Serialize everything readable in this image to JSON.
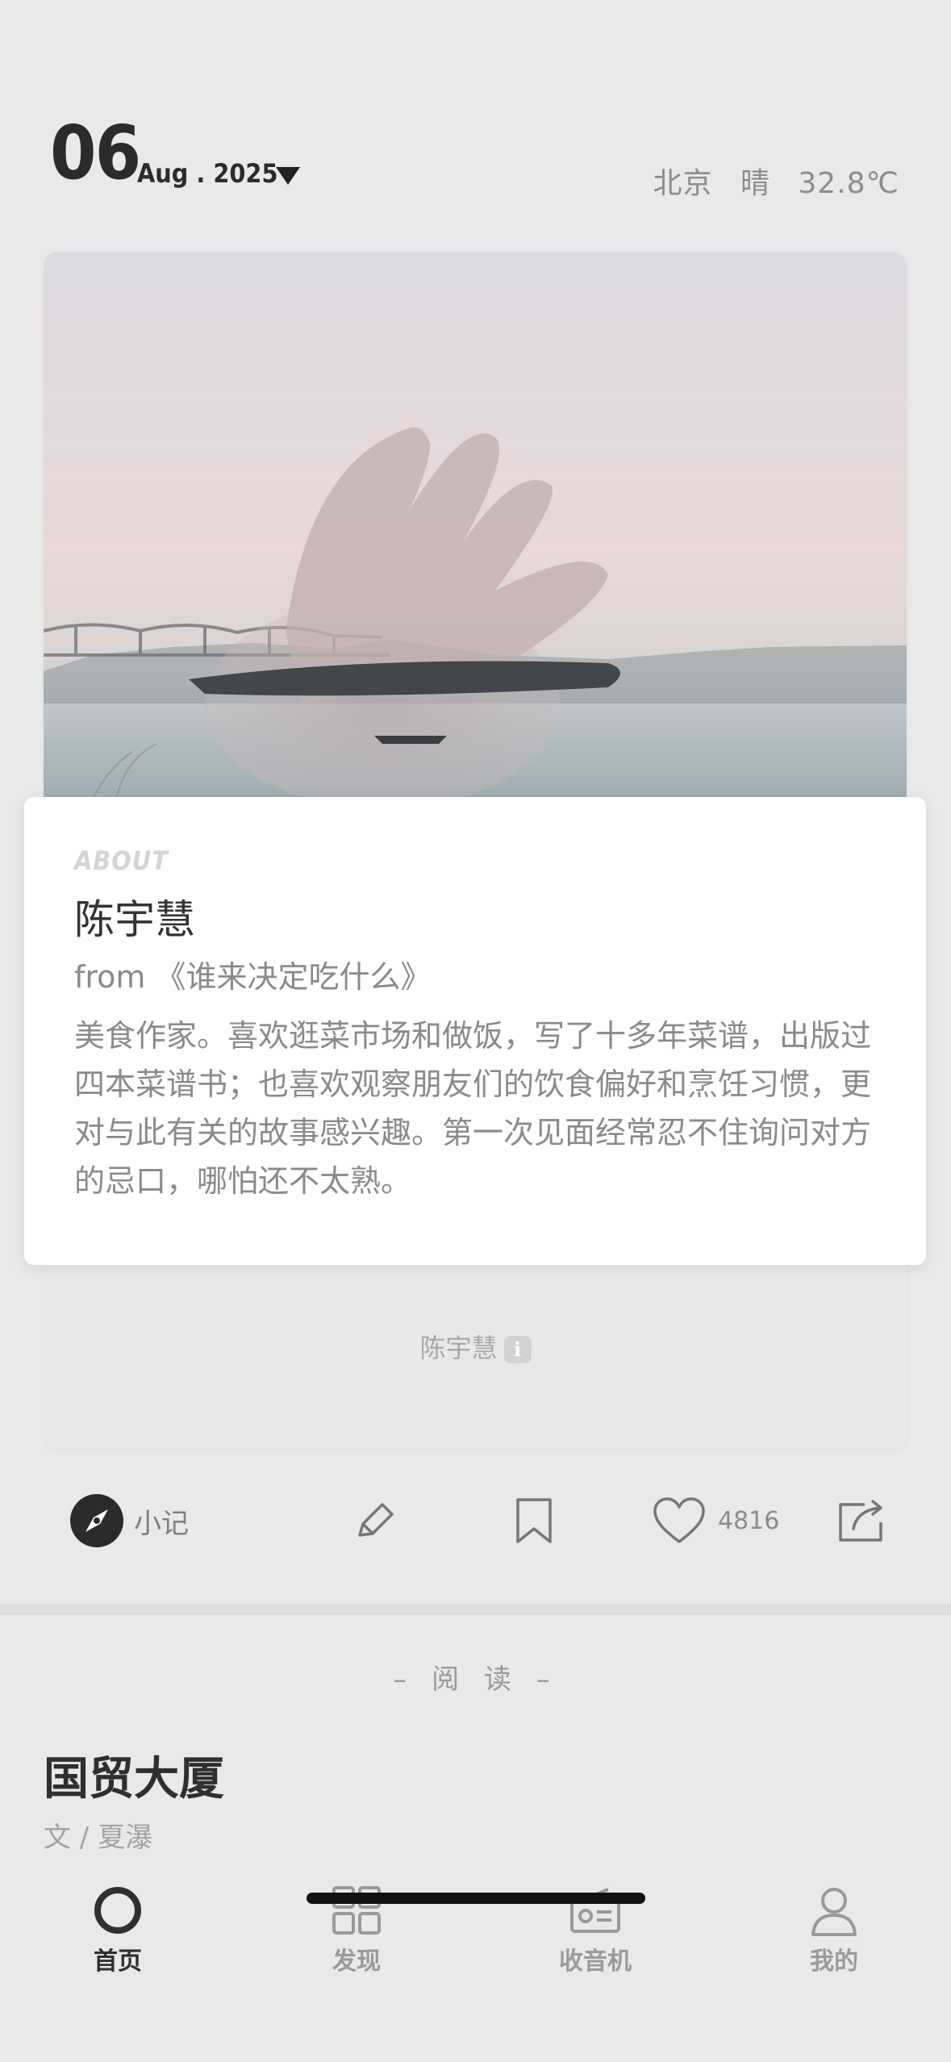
{
  "header": {
    "day": "06",
    "month_year": "Aug . 2025",
    "weather": {
      "city": "北京",
      "condition": "晴",
      "temperature": "32.8℃"
    }
  },
  "about": {
    "tag": "ABOUT",
    "name": "陈宇慧",
    "from": "from 《谁来决定吃什么》",
    "bio": "美食作家。喜欢逛菜市场和做饭，写了十多年菜谱，出版过四本菜谱书；也喜欢观察朋友们的饮食偏好和烹饪习惯，更对与此有关的故事感兴趣。第一次见面经常忍不住询问对方的忌口，哪怕还不太熟。"
  },
  "photo_credit": {
    "name": "陈宇慧",
    "info_icon": "info-icon"
  },
  "actions": {
    "note_label": "小记",
    "likes": "4816",
    "icons": [
      "compass-icon",
      "pencil-icon",
      "bookmark-icon",
      "heart-icon",
      "share-icon"
    ]
  },
  "reading": {
    "section_label": "– 阅 读 –",
    "title": "国贸大厦",
    "author": "文 / 夏瀑"
  },
  "tabbar": {
    "tabs": [
      {
        "label": "首页",
        "icon": "home-circle-icon",
        "active": true
      },
      {
        "label": "发现",
        "icon": "grid-icon",
        "active": false
      },
      {
        "label": "收音机",
        "icon": "radio-icon",
        "active": false
      },
      {
        "label": "我的",
        "icon": "user-icon",
        "active": false
      }
    ]
  },
  "colors": {
    "background": "#e9e9e9",
    "card": "#ffffff",
    "text_primary": "#333333",
    "text_secondary": "#8a8a8a"
  }
}
